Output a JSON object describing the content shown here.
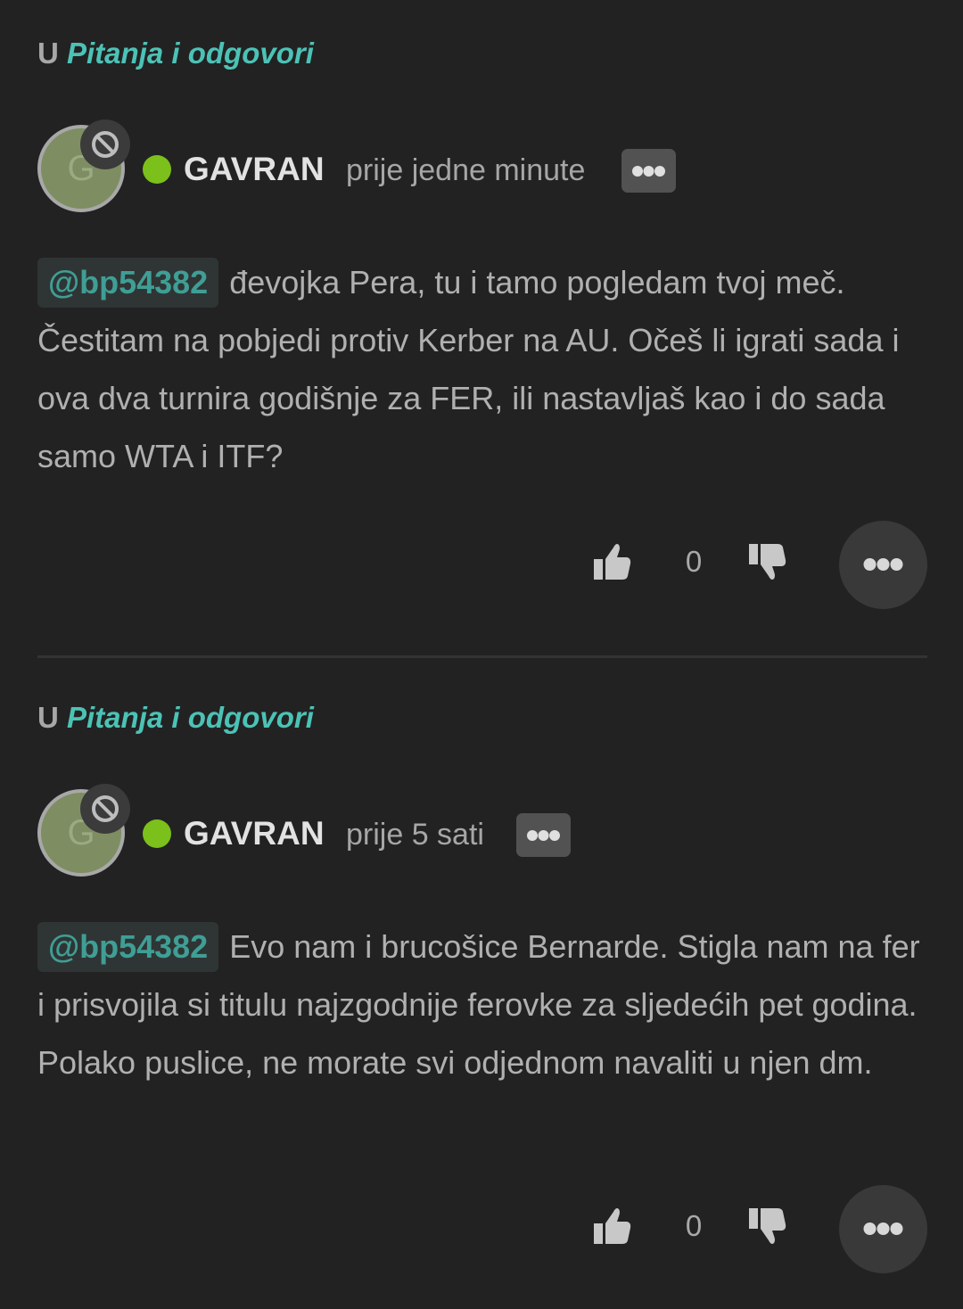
{
  "colors": {
    "background": "#222222",
    "category_link": "#4cc2b6",
    "mention_text": "#3f9e95",
    "mention_bg": "#2f3534",
    "online": "#7cc01b",
    "username": "#e2e2e2",
    "body_text": "#b0b0b0"
  },
  "posts": [
    {
      "category_prefix": "U",
      "category_name": "Pitanja i odgovori",
      "avatar_letter": "G",
      "avatar_icon": "ban-icon",
      "status": "online",
      "username": "GAVRAN",
      "timestamp": "prije jedne minute",
      "menu_icon": "more-horizontal-icon",
      "mention": "@bp54382",
      "paragraphs": [
        "đevojka Pera, tu i tamo pogledam tvoj meč. Čestitam na pobjedi protiv Kerber na AU. Očeš li igrati sada i ova dva turnira godišnje za FER, ili nastavljaš kao i do sada samo WTA i ITF?"
      ],
      "upvote_icon": "thumbs-up-icon",
      "votes": "0",
      "downvote_icon": "thumbs-down-icon",
      "more_icon": "more-horizontal-icon"
    },
    {
      "category_prefix": "U",
      "category_name": "Pitanja i odgovori",
      "avatar_letter": "G",
      "avatar_icon": "ban-icon",
      "status": "online",
      "username": "GAVRAN",
      "timestamp": "prije 5 sati",
      "menu_icon": "more-horizontal-icon",
      "mention": "@bp54382",
      "paragraphs": [
        "Evo nam i brucošice Bernarde. Stigla nam na fer i prisvojila si titulu najzgodnije ferovke za sljedećih pet godina.",
        "Polako puslice, ne morate svi odjednom navaliti u njen dm."
      ],
      "upvote_icon": "thumbs-up-icon",
      "votes": "0",
      "downvote_icon": "thumbs-down-icon",
      "more_icon": "more-horizontal-icon"
    }
  ]
}
